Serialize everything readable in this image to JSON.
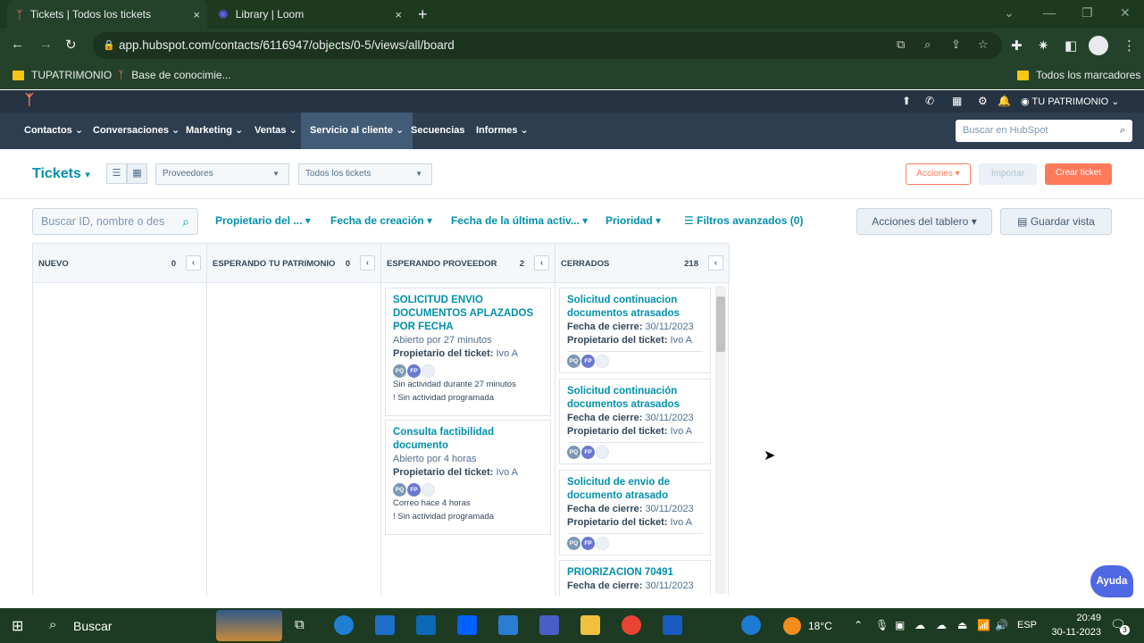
{
  "browser": {
    "tabs": [
      {
        "title": "Tickets | Todos los tickets",
        "close": "×"
      },
      {
        "title": "Library | Loom",
        "close": "×"
      }
    ],
    "new_tab": "+",
    "url": "app.hubspot.com/contacts/6116947/objects/0-5/views/all/board",
    "bookmarks": [
      "TUPATRIMONIO",
      "Base de conocimie..."
    ],
    "all_bookmarks": "Todos los marcadores"
  },
  "hubspot": {
    "account": "TU PATRIMONIO",
    "nav": [
      "Contactos",
      "Conversaciones",
      "Marketing",
      "Ventas",
      "Servicio al cliente",
      "Secuencias",
      "Informes"
    ],
    "search_placeholder": "Buscar en HubSpot",
    "page_title": "Tickets",
    "pipeline": "Proveedores",
    "view": "Todos los tickets",
    "buttons": {
      "actions": "Acciones",
      "import": "Importar",
      "create": "Crear ticket"
    },
    "search_tickets": "Buscar ID, nombre o des",
    "filters": [
      "Propietario del ...",
      "Fecha de creación",
      "Fecha de la última activ...",
      "Prioridad"
    ],
    "advanced_filters": "Filtros avanzados (0)",
    "board_actions": "Acciones del tablero",
    "save_view": "Guardar vista",
    "help": "Ayuda"
  },
  "columns": [
    {
      "name": "NUEVO",
      "count": "0"
    },
    {
      "name": "ESPERANDO TU PATRIMONIO",
      "count": "0"
    },
    {
      "name": "ESPERANDO PROVEEDOR",
      "count": "2"
    },
    {
      "name": "CERRADOS",
      "count": "218"
    }
  ],
  "proveedor_cards": [
    {
      "title": "SOLICITUD ENVIO DOCUMENTOS APLAZADOS POR FECHA",
      "opened": "Abierto por 27 minutos",
      "owner_label": "Propietario del ticket:",
      "owner": "Ivo A",
      "activity": "Sin actividad durante 27 minutos",
      "scheduled": "Sin actividad programada"
    },
    {
      "title": "Consulta factibilidad documento",
      "opened": "Abierto por 4 horas",
      "owner_label": "Propietario del ticket:",
      "owner": "Ivo A",
      "activity": "Correo hace 4 horas",
      "scheduled": "Sin actividad programada"
    }
  ],
  "cerrados_cards": [
    {
      "title": "Solicitud continuacion documentos atrasados",
      "close_label": "Fecha de cierre:",
      "close_date": "30/11/2023",
      "owner_label": "Propietario del ticket:",
      "owner": "Ivo A"
    },
    {
      "title": "Solicitud continuación documentos atrasados",
      "close_label": "Fecha de cierre:",
      "close_date": "30/11/2023",
      "owner_label": "Propietario del ticket:",
      "owner": "Ivo A"
    },
    {
      "title": "Solicitud de envio de documento atrasado",
      "close_label": "Fecha de cierre:",
      "close_date": "30/11/2023",
      "owner_label": "Propietario del ticket:",
      "owner": "Ivo A"
    },
    {
      "title": "PRIORIZACION 70491",
      "close_label": "Fecha de cierre:",
      "close_date": "30/11/2023"
    }
  ],
  "avatars": [
    "PQ",
    "FP"
  ],
  "taskbar": {
    "search": "Buscar",
    "weather": "18°C",
    "lang": "ESP",
    "time": "20:49",
    "date": "30-11-2023",
    "notif": "3"
  }
}
